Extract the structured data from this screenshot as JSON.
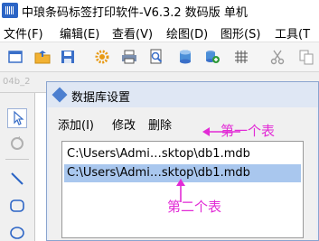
{
  "window": {
    "title": "中琅条码标签打印软件-V6.3.2 数码版 单机"
  },
  "menubar": {
    "items": [
      "文件(F)",
      "编辑(E)",
      "查看(V)",
      "绘图(D)",
      "图形(S)",
      "工具(T"
    ]
  },
  "ruler": {
    "text": "04b_2"
  },
  "dialog": {
    "title": "数据库设置",
    "menu": [
      "添加(I)",
      "修改",
      "删除"
    ],
    "rows": [
      "C:\\Users\\Admi…sktop\\db1.mdb",
      "C:\\Users\\Admi…sktop\\db1.mdb"
    ],
    "selected_row": 1
  },
  "annotations": {
    "first": "第一个表",
    "second": "第二个表",
    "color": "#e22bd6"
  }
}
